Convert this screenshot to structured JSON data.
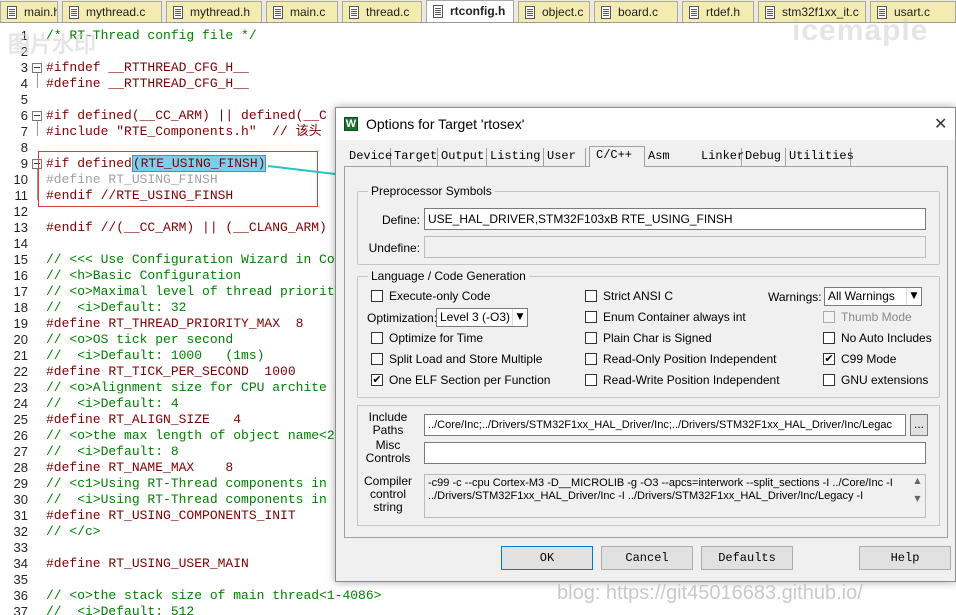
{
  "file_tabs": [
    "main.h",
    "mythread.c",
    "mythread.h",
    "main.c",
    "thread.c",
    "rtconfig.h",
    "object.c",
    "board.c",
    "rtdef.h",
    "stm32f1xx_it.c",
    "usart.c"
  ],
  "active_file_tab": "rtconfig.h",
  "watermark_left": "图片水印",
  "watermark_right": "icemaple",
  "blog_watermark": "blog: https://git45016683.github.io/",
  "code_lines": [
    {
      "n": "1",
      "t": "/* RT-Thread config file */"
    },
    {
      "n": "2",
      "t": ""
    },
    {
      "n": "3",
      "t": "#ifndef __RTTHREAD_CFG_H__"
    },
    {
      "n": "4",
      "t": "#define __RTTHREAD_CFG_H__"
    },
    {
      "n": "5",
      "t": ""
    },
    {
      "n": "6",
      "t": "#if defined(__CC_ARM) || defined(__C"
    },
    {
      "n": "7",
      "t": "#include \"RTE_Components.h\"  // 该头"
    },
    {
      "n": "8",
      "t": ""
    },
    {
      "n": "9",
      "t": "#if defined"
    },
    {
      "n": "10",
      "t": "#define RT_USING_FINSH"
    },
    {
      "n": "11",
      "t": "#endif //RTE_USING_FINSH"
    },
    {
      "n": "12",
      "t": ""
    },
    {
      "n": "13",
      "t": "#endif //(__CC_ARM) || (__CLANG_ARM)"
    },
    {
      "n": "14",
      "t": ""
    },
    {
      "n": "15",
      "t": "// <<< Use Configuration Wizard in Co"
    },
    {
      "n": "16",
      "t": "// <h>Basic Configuration"
    },
    {
      "n": "17",
      "t": "// <o>Maximal level of thread priorit"
    },
    {
      "n": "18",
      "t": "//  <i>Default: 32"
    },
    {
      "n": "19",
      "t": "#define RT_THREAD_PRIORITY_MAX  8"
    },
    {
      "n": "20",
      "t": "// <o>OS tick per second"
    },
    {
      "n": "21",
      "t": "//  <i>Default: 1000   (1ms)"
    },
    {
      "n": "22",
      "t": "#define RT_TICK_PER_SECOND  1000"
    },
    {
      "n": "23",
      "t": "// <o>Alignment size for CPU archite"
    },
    {
      "n": "24",
      "t": "//  <i>Default: 4"
    },
    {
      "n": "25",
      "t": "#define RT_ALIGN_SIZE   4"
    },
    {
      "n": "26",
      "t": "// <o>the max length of object name<2"
    },
    {
      "n": "27",
      "t": "//  <i>Default: 8"
    },
    {
      "n": "28",
      "t": "#define RT_NAME_MAX    8"
    },
    {
      "n": "29",
      "t": "// <c1>Using RT-Thread components in"
    },
    {
      "n": "30",
      "t": "//  <i>Using RT-Thread components in"
    },
    {
      "n": "31",
      "t": "#define RT_USING_COMPONENTS_INIT"
    },
    {
      "n": "32",
      "t": "// </c>"
    },
    {
      "n": "33",
      "t": ""
    },
    {
      "n": "34",
      "t": "#define RT_USING_USER_MAIN"
    },
    {
      "n": "35",
      "t": ""
    },
    {
      "n": "36",
      "t": "// <o>the stack size of main thread<1-4086>"
    },
    {
      "n": "37",
      "t": "//  <i>Default: 512"
    }
  ],
  "selected_token": "(RTE_USING_FINSH)",
  "dialog": {
    "title": "Options for Target 'rtosex'",
    "close": "✕",
    "tabs": [
      "Device",
      "Target",
      "Output",
      "Listing",
      "User",
      "C/C++",
      "Asm",
      "Linker",
      "Debug",
      "Utilities"
    ],
    "active_tab": "C/C++",
    "preprocessor": {
      "group": "Preprocessor Symbols",
      "define_label": "Define:",
      "define_value": "USE_HAL_DRIVER,STM32F103xB RTE_USING_FINSH",
      "undefine_label": "Undefine:",
      "undefine_value": ""
    },
    "langgen": {
      "group": "Language / Code Generation",
      "execute_only": "Execute-only Code",
      "optimization_label": "Optimization:",
      "optimization_value": "Level 3 (-O3)",
      "optimize_time": "Optimize for Time",
      "split_load": "Split Load and Store Multiple",
      "one_elf": "One ELF Section per Function",
      "strict_ansi": "Strict ANSI C",
      "enum_container": "Enum Container always int",
      "plain_char": "Plain Char is Signed",
      "readonly_pi": "Read-Only Position Independent",
      "readwrite_pi": "Read-Write Position Independent",
      "warnings_label": "Warnings:",
      "warnings_value": "All Warnings",
      "thumb_mode": "Thumb Mode",
      "no_auto_includes": "No Auto Includes",
      "c99_mode": "C99 Mode",
      "gnu_ext": "GNU extensions",
      "check": "✔"
    },
    "include_label_1": "Include",
    "include_label_2": "Paths",
    "include_value": "../Core/Inc;../Drivers/STM32F1xx_HAL_Driver/Inc;../Drivers/STM32F1xx_HAL_Driver/Inc/Legac",
    "misc_label_1": "Misc",
    "misc_label_2": "Controls",
    "misc_value": "",
    "compiler_label_1": "Compiler",
    "compiler_label_2": "control",
    "compiler_label_3": "string",
    "compiler_value": "-c99 -c --cpu Cortex-M3 -D__MICROLIB -g -O3 --apcs=interwork --split_sections -I ../Core/Inc -I\n../Drivers/STM32F1xx_HAL_Driver/Inc -I ../Drivers/STM32F1xx_HAL_Driver/Inc/Legacy -I",
    "ellipsis": "...",
    "buttons": {
      "ok": "OK",
      "cancel": "Cancel",
      "defaults": "Defaults",
      "help": "Help"
    }
  },
  "colors": {
    "comment": "#008000",
    "preproc": "#800000",
    "highlight": "#79d0ee",
    "annotation_red": "#e23a3a",
    "annotation_arrow": "#26c4c4"
  }
}
